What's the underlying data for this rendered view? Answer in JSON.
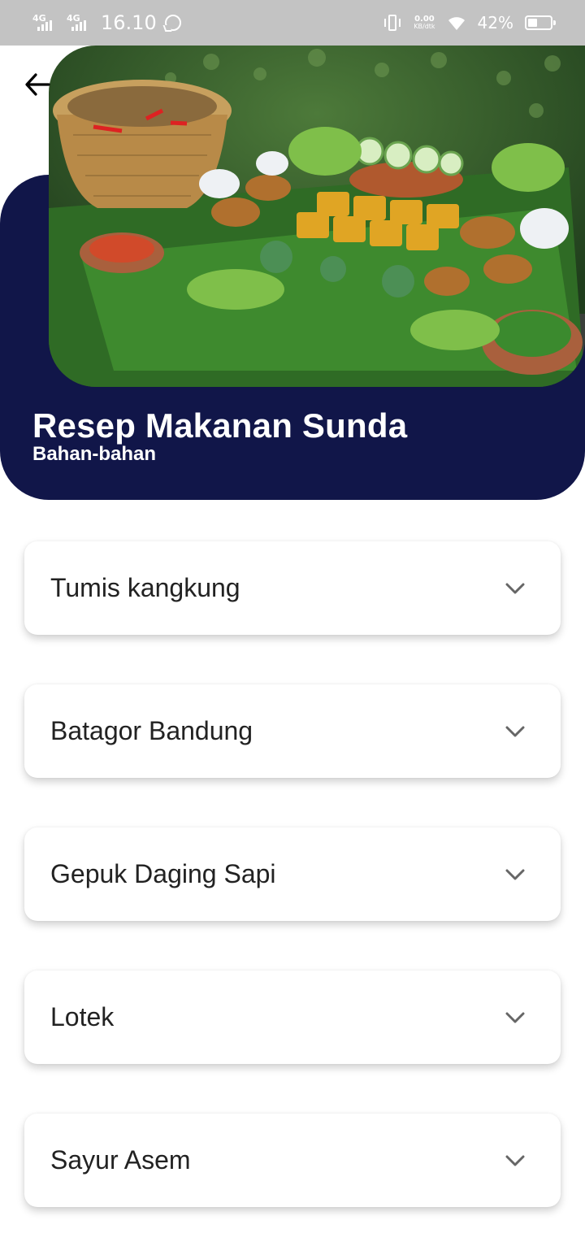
{
  "status_bar": {
    "signal1_label": "4G",
    "signal2_label": "4G",
    "time": "16.10",
    "net_speed_value": "0.00",
    "net_speed_unit": "KB/dtk",
    "battery_percent": "42%",
    "battery_level": 0.42,
    "icons": [
      "whatsapp-icon",
      "vibrate-icon",
      "wifi-icon",
      "battery-icon"
    ]
  },
  "header": {
    "back_icon": "arrow-left-icon",
    "title": "Resep Makanan Sunda",
    "subtitle": "Bahan-bahan",
    "image": "sundanese-food-platter"
  },
  "recipes": [
    {
      "label": "Tumis kangkung"
    },
    {
      "label": "Batagor Bandung"
    },
    {
      "label": "Gepuk Daging Sapi"
    },
    {
      "label": "Lotek"
    },
    {
      "label": "Sayur Asem"
    }
  ],
  "colors": {
    "header_bg": "#111649",
    "status_bar_bg": "#c3c3c3",
    "card_bg": "#ffffff",
    "chevron": "#666666"
  }
}
